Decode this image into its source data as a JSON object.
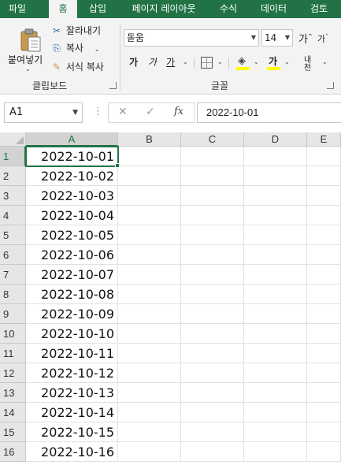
{
  "tabs": [
    {
      "label": "파일",
      "active": false
    },
    {
      "label": "홈",
      "active": true
    },
    {
      "label": "삽입",
      "active": false
    },
    {
      "label": "페이지 레이아웃",
      "active": false
    },
    {
      "label": "수식",
      "active": false
    },
    {
      "label": "데이터",
      "active": false
    },
    {
      "label": "검토",
      "active": false
    }
  ],
  "clipboard": {
    "paste_label": "붙여넣기",
    "cut_label": "잘라내기",
    "copy_label": "복사",
    "format_painter_label": "서식 복사",
    "group_label": "클립보드"
  },
  "font": {
    "font_name": "돋움",
    "font_size": "14",
    "grow_label": "가",
    "shrink_label": "가",
    "bold_label": "가",
    "italic_label": "가",
    "underline_label": "가",
    "font_color_label": "가",
    "phonetic_label": "내천",
    "group_label": "글꼴"
  },
  "formula_bar": {
    "name_box": "A1",
    "fx_label": "fx",
    "value": "2022-10-01"
  },
  "grid": {
    "columns": [
      "A",
      "B",
      "C",
      "D",
      "E"
    ],
    "rows": [
      "1",
      "2",
      "3",
      "4",
      "5",
      "6",
      "7",
      "8",
      "9",
      "10",
      "11",
      "12",
      "13",
      "14",
      "15",
      "16"
    ],
    "values": [
      "2022-10-01",
      "2022-10-02",
      "2022-10-03",
      "2022-10-04",
      "2022-10-05",
      "2022-10-06",
      "2022-10-07",
      "2022-10-08",
      "2022-10-09",
      "2022-10-10",
      "2022-10-11",
      "2022-10-12",
      "2022-10-13",
      "2022-10-14",
      "2022-10-15",
      "2022-10-16"
    ],
    "selected_cell": "A1"
  },
  "colors": {
    "accent": "#217346",
    "ribbon_bg": "#f3f3f3",
    "header_bg": "#e6e6e6"
  }
}
